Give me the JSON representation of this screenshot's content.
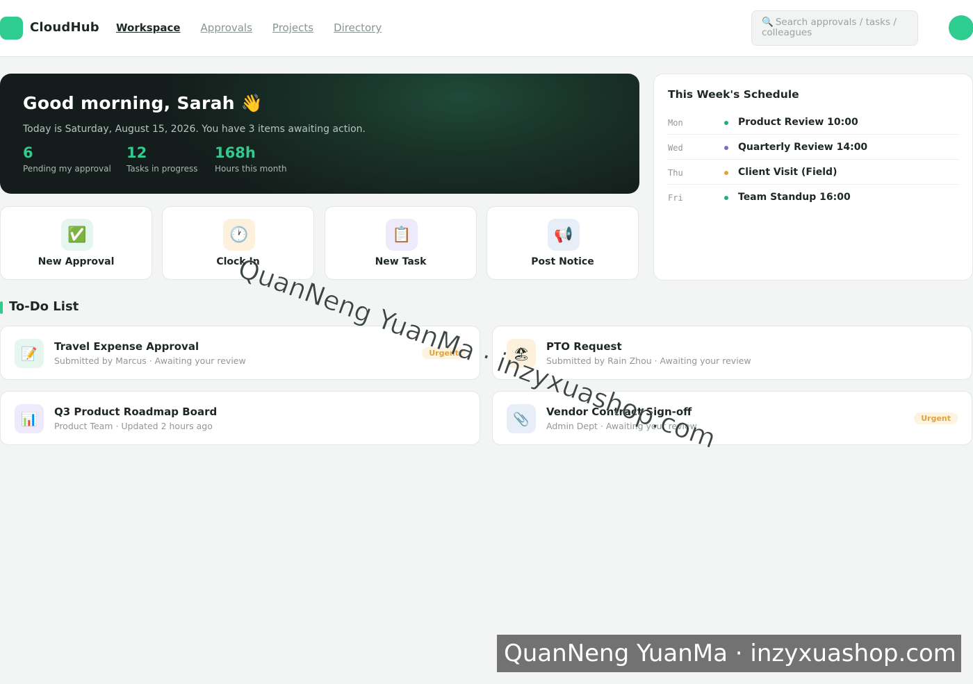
{
  "header": {
    "brand": "CloudHub",
    "nav": [
      "Workspace",
      "Approvals",
      "Projects",
      "Directory"
    ],
    "search_placeholder": "Search approvals / tasks / colleagues",
    "search_icon": "search-icon"
  },
  "hero": {
    "greeting": "Good morning, Sarah",
    "wave": "👋",
    "subtitle": "Today is Saturday, August 15, 2026. You have 3 items awaiting action.",
    "stats": [
      {
        "value": "6",
        "label": "Pending my approval"
      },
      {
        "value": "12",
        "label": "Tasks in progress"
      },
      {
        "value": "168h",
        "label": "Hours this month"
      }
    ]
  },
  "quick_actions": [
    {
      "label": "New Approval",
      "icon": "✅",
      "icon_name": "check-icon",
      "bg": "#e6f6ee"
    },
    {
      "label": "Clock In",
      "icon": "🕐",
      "icon_name": "clock-icon",
      "bg": "#fdf1dd"
    },
    {
      "label": "New Task",
      "icon": "📋",
      "icon_name": "clipboard-icon",
      "bg": "#eeeafc"
    },
    {
      "label": "Post Notice",
      "icon": "📢",
      "icon_name": "megaphone-icon",
      "bg": "#e8eef8"
    }
  ],
  "schedule": {
    "title": "This Week's Schedule",
    "items": [
      {
        "day": "Mon",
        "event": "Product Review 10:00",
        "color": "#22b07a"
      },
      {
        "day": "Wed",
        "event": "Quarterly Review 14:00",
        "color": "#7b6cc9"
      },
      {
        "day": "Thu",
        "event": "Client Visit (Field)",
        "color": "#e0a43a"
      },
      {
        "day": "Fri",
        "event": "Team Standup 16:00",
        "color": "#22b07a"
      }
    ]
  },
  "todo": {
    "title": "To-Do List",
    "items": [
      {
        "title": "Travel Expense Approval",
        "sub": "Submitted by Marcus · Awaiting your review",
        "badge": "Urgent",
        "icon": "📝",
        "icon_name": "memo-icon",
        "bg": "#e6f6ee"
      },
      {
        "title": "PTO Request",
        "sub": "Submitted by Rain Zhou · Awaiting your review",
        "badge": "",
        "icon": "🏖",
        "icon_name": "beach-icon",
        "bg": "#fdf1dd"
      },
      {
        "title": "Q3 Product Roadmap Board",
        "sub": "Product Team · Updated 2 hours ago",
        "badge": "",
        "icon": "📊",
        "icon_name": "bar-chart-icon",
        "bg": "#eeeafc"
      },
      {
        "title": "Vendor Contract Sign-off",
        "sub": "Admin Dept · Awaiting your review",
        "badge": "Urgent",
        "icon": "📎",
        "icon_name": "paperclip-icon",
        "bg": "#e8eef8"
      }
    ]
  },
  "watermark": {
    "diagonal": "QuanNeng YuanMa · inzyxuashop.com",
    "bottom": "QuanNeng YuanMa · inzyxuashop.com"
  }
}
